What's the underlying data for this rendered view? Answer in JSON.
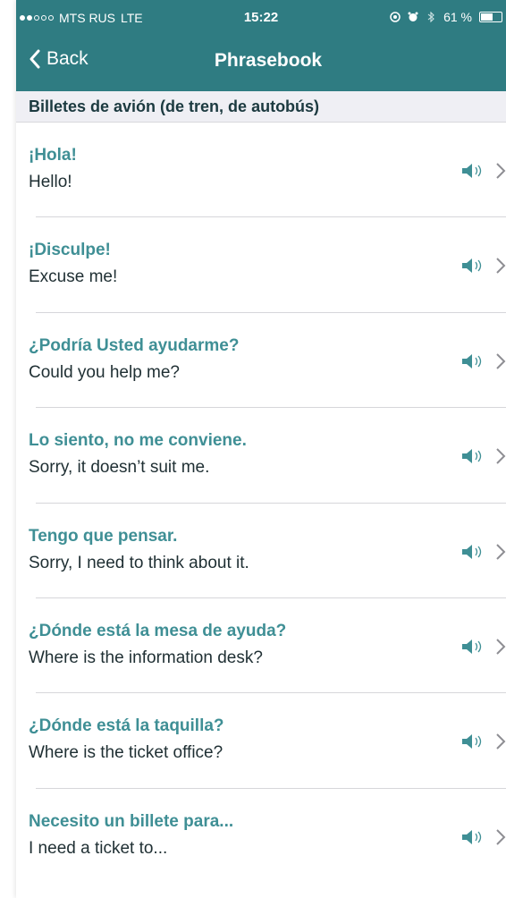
{
  "status_bar": {
    "carrier": "MTS RUS",
    "network": "LTE",
    "time": "15:22",
    "battery_percent": "61 %",
    "battery_level": 0.61,
    "signal_bars_filled": 2,
    "signal_bars_total": 5
  },
  "nav": {
    "back_label": "Back",
    "title": "Phrasebook"
  },
  "section": {
    "title": "Billetes de avión (de tren, de autobús)"
  },
  "phrases": [
    {
      "spanish": "¡Hola!",
      "english": "Hello!"
    },
    {
      "spanish": "¡Disculpe!",
      "english": "Excuse me!"
    },
    {
      "spanish": "¿Podría Usted ayudarme?",
      "english": "Could you help me?"
    },
    {
      "spanish": "Lo siento, no me conviene.",
      "english": "Sorry, it doesn’t suit me."
    },
    {
      "spanish": "Tengo que pensar.",
      "english": "Sorry, I need to think about it."
    },
    {
      "spanish": "¿Dónde está la mesa de ayuda?",
      "english": "Where is the information desk?"
    },
    {
      "spanish": "¿Dónde está la taquilla?",
      "english": "Where is the ticket office?"
    },
    {
      "spanish": "Necesito un billete para...",
      "english": "I need a ticket to..."
    }
  ],
  "colors": {
    "header": "#2f7c82",
    "spanish_text": "#3f8f95",
    "english_text": "#1f2f33",
    "section_bg": "#efeff4",
    "speaker_icon": "#3f8f95",
    "chevron_icon": "#8e8e93"
  },
  "icons": {
    "back": "chevron-left-icon",
    "speaker": "speaker-icon",
    "disclosure": "chevron-right-icon",
    "alarm": "alarm-icon",
    "bluetooth": "bluetooth-icon",
    "lock_rotation": "rotation-lock-icon",
    "battery": "battery-icon"
  }
}
